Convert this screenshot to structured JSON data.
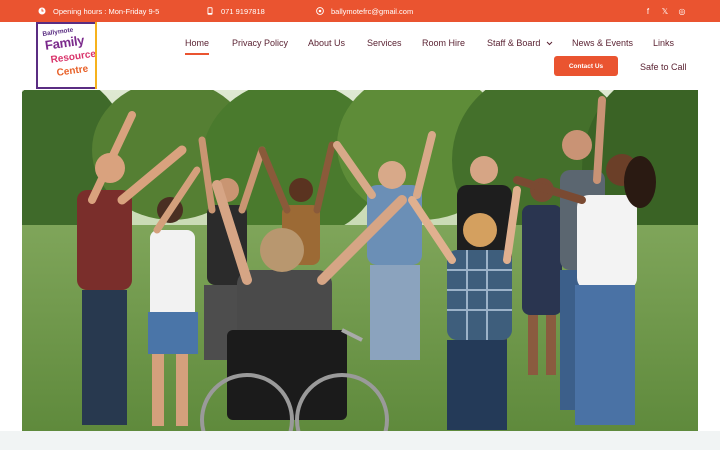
{
  "topbar": {
    "hours": "Opening hours : Mon-Friday 9-5",
    "phone": "071 9197818",
    "email": "ballymotefrc@gmail.com",
    "social": [
      {
        "name": "facebook-icon",
        "glyph": "f"
      },
      {
        "name": "x-icon",
        "glyph": "𝕏"
      },
      {
        "name": "instagram-icon",
        "glyph": "◎"
      }
    ],
    "color": "#ea5430"
  },
  "logo": {
    "line1": "Ballymote",
    "line2": "Family",
    "line3": "Resource",
    "line4": "Centre"
  },
  "nav": {
    "items": [
      {
        "label": "Home",
        "active": true
      },
      {
        "label": "Privacy Policy",
        "active": false
      },
      {
        "label": "About Us",
        "active": false
      },
      {
        "label": "Services",
        "active": false
      },
      {
        "label": "Room Hire",
        "active": false
      },
      {
        "label": "Staff & Board",
        "active": false,
        "dropdown": true
      },
      {
        "label": "News & Events",
        "active": false
      },
      {
        "label": "Links",
        "active": false
      }
    ],
    "contact_label": "Contact Us",
    "safe_label": "Safe to Call",
    "accent": "#ea5430",
    "text_color": "#5b2333"
  },
  "hero": {
    "image": "group-holding-hands-circle-photo"
  }
}
